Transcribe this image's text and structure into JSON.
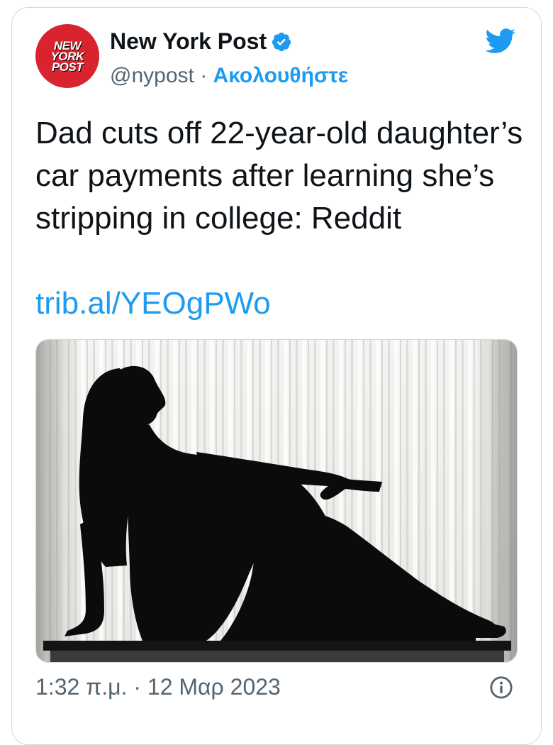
{
  "account": {
    "avatar_lines": [
      "NEW",
      "YORK",
      "POST"
    ],
    "name": "New York Post",
    "handle": "@nypost",
    "separator": "·",
    "follow_label": "Ακολουθήστε"
  },
  "tweet": {
    "text": "Dad cuts off 22-year-old daughter’s car payments after learning she’s stripping in college: Reddit",
    "link": "trib.al/YEOgPWo"
  },
  "footer": {
    "timestamp": "1:32 π.μ. · 12 Μαρ 2023"
  },
  "icons": {
    "verified": "verified-badge-icon",
    "logo": "twitter-bird-icon",
    "info": "info-icon"
  },
  "colors": {
    "accent": "#1d9bf0",
    "brand_red": "#d9232e",
    "text": "#0f1419",
    "muted": "#536471"
  }
}
